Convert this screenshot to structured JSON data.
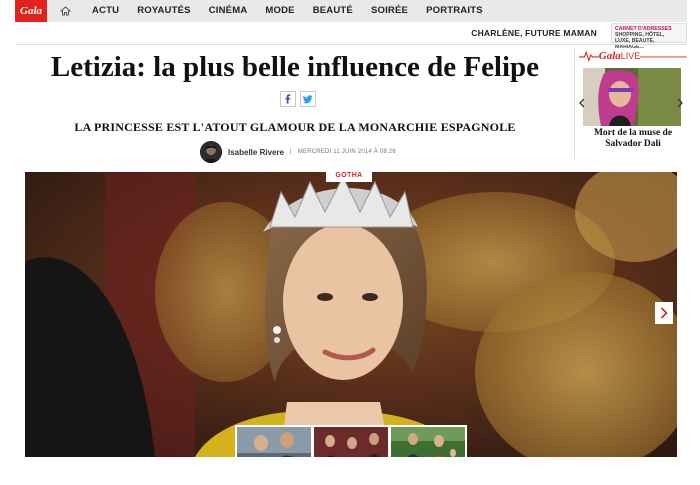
{
  "nav": {
    "logo": "Gala",
    "links": [
      "ACTU",
      "ROYAUTÉS",
      "CINÉMA",
      "MODE",
      "BEAUTÉ",
      "SOIRÉE",
      "PORTRAITS"
    ]
  },
  "subnav": {
    "link": "CHARLÈNE, FUTURE MAMAN",
    "promo_line1": "CARNET D'ADRESSES",
    "promo_line2": "SHOPPING, HÔTEL,",
    "promo_line3": "LUXE, BEAUTÉ, MARIAGE..."
  },
  "article": {
    "title": "Letizia: la plus belle influence de Felipe",
    "subtitle": "LA PRINCESSE EST L'ATOUT GLAMOUR DE LA MONARCHIE ESPAGNOLE",
    "author": "Isabelle Rivere",
    "date": "MERCREDI 11 JUIN 2014 À 08:26",
    "tag": "GOTHA"
  },
  "live": {
    "brand": "Gala",
    "brand_suffix": "LIVE",
    "caption": "Mort de la muse de Salvador Dali"
  },
  "icons": {
    "facebook": "f",
    "twitter": "twitter-bird",
    "home": "home-icon",
    "next": "chevron-right-icon"
  },
  "colors": {
    "brand_red": "#e2231a",
    "nav_bg": "#e9e9e9"
  }
}
